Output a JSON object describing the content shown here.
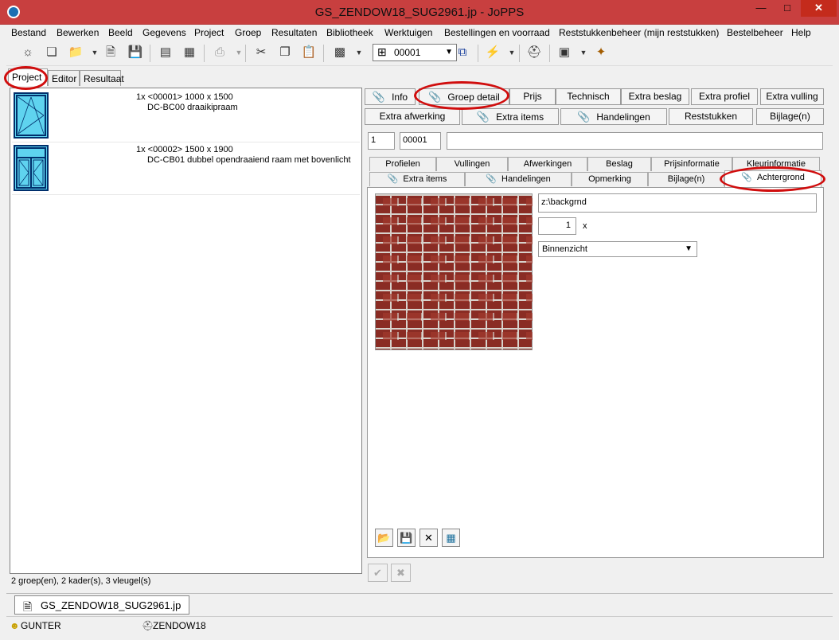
{
  "window": {
    "title": "GS_ZENDOW18_SUG2961.jp - JoPPS"
  },
  "menu": [
    "Bestand",
    "Bewerken",
    "Beeld",
    "Gegevens",
    "Project",
    "Groep",
    "Resultaten",
    "Bibliotheek",
    "Werktuigen",
    "Bestellingen en voorraad",
    "Reststukkenbeheer (mijn reststukken)",
    "Bestelbeheer",
    "Help"
  ],
  "toolbar": {
    "combo_value": "00001"
  },
  "top_tabs": [
    "Project",
    "Editor",
    "Resultaat"
  ],
  "items": [
    {
      "line1": "1x <00001> 1000 x 1500",
      "line2": "DC-BC00 draaikipraam"
    },
    {
      "line1": "1x <00002> 1500 x 1900",
      "line2": "DC-CB01 dubbel opendraaiend raam met bovenlicht"
    }
  ],
  "status_left": "2 groep(en), 2 kader(s), 3 vleugel(s)",
  "buttons_row1": [
    "Info",
    "Groep detail",
    "Prijs",
    "Technisch",
    "Extra beslag",
    "Extra profiel",
    "Extra vulling"
  ],
  "buttons_row2": [
    "Extra afwerking",
    "Extra items",
    "Handelingen",
    "Reststukken",
    "Bijlage(n)"
  ],
  "fields": {
    "qty": "1",
    "code": "00001",
    "desc": ""
  },
  "tabs_row1": [
    "Profielen",
    "Vullingen",
    "Afwerkingen",
    "Beslag",
    "Prijsinformatie",
    "Kleurinformatie"
  ],
  "tabs_row2": [
    "Extra items",
    "Handelingen",
    "Opmerking",
    "Bijlage(n)",
    "Achtergrond"
  ],
  "background": {
    "path": "z:\\backgrnd",
    "scale": "1",
    "scale_unit": "x",
    "view": "Binnenzicht"
  },
  "document_tab": "GS_ZENDOW18_SUG2961.jp",
  "statusbar": {
    "user": "GUNTER",
    "db": "ZENDOW18"
  }
}
